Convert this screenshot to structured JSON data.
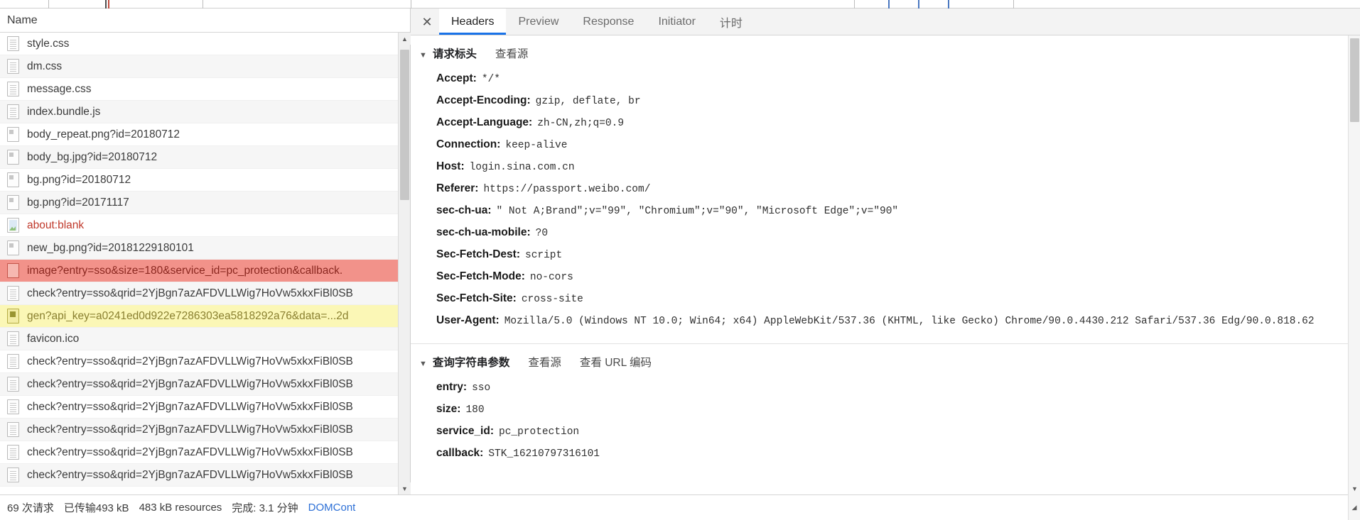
{
  "file_list": {
    "column_header": "Name",
    "rows": [
      {
        "name": "style.css",
        "icon": "document-icon",
        "state": "normal"
      },
      {
        "name": "dm.css",
        "icon": "document-icon",
        "state": "normal"
      },
      {
        "name": "message.css",
        "icon": "document-icon",
        "state": "normal"
      },
      {
        "name": "index.bundle.js",
        "icon": "document-icon",
        "state": "normal"
      },
      {
        "name": "body_repeat.png?id=20180712",
        "icon": "image-icon",
        "state": "normal"
      },
      {
        "name": "body_bg.jpg?id=20180712",
        "icon": "image-icon",
        "state": "normal"
      },
      {
        "name": "bg.png?id=20180712",
        "icon": "image-icon",
        "state": "normal"
      },
      {
        "name": "bg.png?id=20171117",
        "icon": "image-icon",
        "state": "normal"
      },
      {
        "name": "about:blank",
        "icon": "page-image-icon",
        "state": "link"
      },
      {
        "name": "new_bg.png?id=20181229180101",
        "icon": "image-icon",
        "state": "normal"
      },
      {
        "name": "image?entry=sso&size=180&service_id=pc_protection&callback.",
        "icon": "error-icon",
        "state": "error"
      },
      {
        "name": "check?entry=sso&qrid=2YjBgn7azAFDVLLWig7HoVw5xkxFiBl0SB",
        "icon": "document-icon",
        "state": "normal"
      },
      {
        "name": "gen?api_key=a0241ed0d922e7286303ea5818292a76&data=...2d",
        "icon": "warning-icon",
        "state": "warn"
      },
      {
        "name": "favicon.ico",
        "icon": "document-icon",
        "state": "normal"
      },
      {
        "name": "check?entry=sso&qrid=2YjBgn7azAFDVLLWig7HoVw5xkxFiBl0SB",
        "icon": "document-icon",
        "state": "normal"
      },
      {
        "name": "check?entry=sso&qrid=2YjBgn7azAFDVLLWig7HoVw5xkxFiBl0SB",
        "icon": "document-icon",
        "state": "normal"
      },
      {
        "name": "check?entry=sso&qrid=2YjBgn7azAFDVLLWig7HoVw5xkxFiBl0SB",
        "icon": "document-icon",
        "state": "normal"
      },
      {
        "name": "check?entry=sso&qrid=2YjBgn7azAFDVLLWig7HoVw5xkxFiBl0SB",
        "icon": "document-icon",
        "state": "normal"
      },
      {
        "name": "check?entry=sso&qrid=2YjBgn7azAFDVLLWig7HoVw5xkxFiBl0SB",
        "icon": "document-icon",
        "state": "normal"
      },
      {
        "name": "check?entry=sso&qrid=2YjBgn7azAFDVLLWig7HoVw5xkxFiBl0SB",
        "icon": "document-icon",
        "state": "normal"
      }
    ]
  },
  "status_bar": {
    "requests": "69 次请求",
    "transferred": "已传输493 kB",
    "resources": "483 kB resources",
    "finish": "完成: 3.1 分钟",
    "domcontent": "DOMCont"
  },
  "details": {
    "close_label": "✕",
    "tabs": [
      {
        "label": "Headers",
        "active": true
      },
      {
        "label": "Preview",
        "active": false
      },
      {
        "label": "Response",
        "active": false
      },
      {
        "label": "Initiator",
        "active": false
      },
      {
        "label": "计时",
        "active": false
      }
    ],
    "request_headers": {
      "caret": "▼",
      "title": "请求标头",
      "view_source": "查看源",
      "items": [
        {
          "key": "Accept:",
          "value": "*/*"
        },
        {
          "key": "Accept-Encoding:",
          "value": "gzip, deflate, br"
        },
        {
          "key": "Accept-Language:",
          "value": "zh-CN,zh;q=0.9"
        },
        {
          "key": "Connection:",
          "value": "keep-alive"
        },
        {
          "key": "Host:",
          "value": "login.sina.com.cn"
        },
        {
          "key": "Referer:",
          "value": "https://passport.weibo.com/"
        },
        {
          "key": "sec-ch-ua:",
          "value": "\" Not A;Brand\";v=\"99\", \"Chromium\";v=\"90\", \"Microsoft Edge\";v=\"90\""
        },
        {
          "key": "sec-ch-ua-mobile:",
          "value": "?0"
        },
        {
          "key": "Sec-Fetch-Dest:",
          "value": "script"
        },
        {
          "key": "Sec-Fetch-Mode:",
          "value": "no-cors"
        },
        {
          "key": "Sec-Fetch-Site:",
          "value": "cross-site"
        },
        {
          "key": "User-Agent:",
          "value": "Mozilla/5.0 (Windows NT 10.0; Win64; x64) AppleWebKit/537.36 (KHTML, like Gecko) Chrome/90.0.4430.212 Safari/537.36 Edg/90.0.818.62"
        }
      ]
    },
    "query_string": {
      "caret": "▼",
      "title": "查询字符串参数",
      "view_source": "查看源",
      "view_url_encoded": "查看 URL 编码",
      "items": [
        {
          "key": "entry:",
          "value": "sso"
        },
        {
          "key": "size:",
          "value": "180"
        },
        {
          "key": "service_id:",
          "value": "pc_protection"
        },
        {
          "key": "callback:",
          "value": "STK_16210797316101"
        }
      ]
    }
  },
  "colors": {
    "accent": "#1a73e8",
    "error_row": "#f2928a",
    "warn_row": "#fbf7b6",
    "link": "#2c6fd6"
  }
}
